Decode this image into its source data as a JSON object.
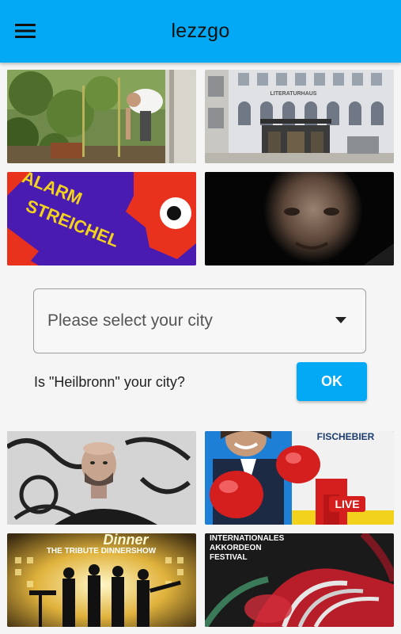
{
  "app": {
    "title": "lezzgo",
    "menu_icon": "hamburger-menu-icon"
  },
  "events": [
    {
      "id": "tile-1",
      "image": "person-gardening-photo"
    },
    {
      "id": "tile-2",
      "image": "literaturhaus-building-photo",
      "sign_text": "LITERATURHAUS"
    },
    {
      "id": "tile-3",
      "image": "alarm-streichel-poster",
      "poster_lines": [
        "ALARM",
        "STREICHEL"
      ]
    },
    {
      "id": "tile-4",
      "image": "man-portrait-dark-photo"
    },
    {
      "id": "tile-5",
      "image": "bald-man-graffiti-photo"
    },
    {
      "id": "tile-6",
      "image": "boxer-poster",
      "poster_top": "FISCHEBIER",
      "badge": "LIVE"
    },
    {
      "id": "tile-7",
      "image": "dinner-show-poster",
      "poster_script": "Dinner",
      "poster_line": "THE TRIBUTE DINNERSHOW"
    },
    {
      "id": "tile-8",
      "image": "accordion-festival-poster",
      "poster_lines": [
        "INTERNATIONALES",
        "AKKORDEON",
        "FESTIVAL"
      ]
    }
  ],
  "city_picker": {
    "label": "Please select your city",
    "arrow_icon": "dropdown-arrow-icon"
  },
  "city_prompt": {
    "question": "Is \"Heilbronn\" your city?",
    "ok_label": "OK"
  },
  "colors": {
    "app_bar": "#03a9f4",
    "accent": "#03a9f4",
    "background": "#f5f5f5"
  }
}
